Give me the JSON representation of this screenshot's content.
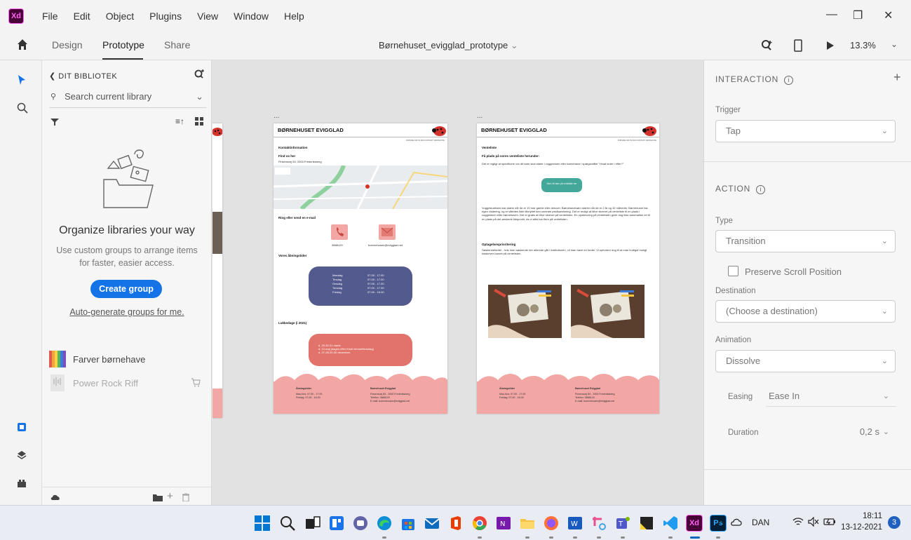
{
  "app": {
    "logo_text": "Xd",
    "menu": [
      "File",
      "Edit",
      "Object",
      "Plugins",
      "View",
      "Window",
      "Help"
    ],
    "document_title": "Børnehuset_evigglad_prototype",
    "zoom": "13.3%"
  },
  "mode_tabs": [
    {
      "label": "Design",
      "active": false
    },
    {
      "label": "Prototype",
      "active": true
    },
    {
      "label": "Share",
      "active": false
    }
  ],
  "library": {
    "back_label": "DIT BIBLIOTEK",
    "search_placeholder": "Search current library",
    "empty_title": "Organize libraries your way",
    "empty_desc": "Use custom groups to arrange items for faster, easier access.",
    "create_group_label": "Create group",
    "auto_generate_label": "Auto-generate groups for me.",
    "items": [
      {
        "label": "Farver børnehave"
      },
      {
        "label": "Power Rock Riff"
      }
    ]
  },
  "artboard_left": {
    "dots": "...",
    "site_title": "BØRNEHUSET EVIGGLAD",
    "nav": "FORSIDE  OM OS  INFO  KONTAKT  VENTELISTE",
    "contact_heading": "Kontaktinformation",
    "find_heading": "Find os her",
    "address": "Finsensvej 83, 2000 Frederiksberg",
    "call_heading": "Ring eller send en e-mail",
    "phone": "3888129",
    "email": "boernehusen@evigglad.net",
    "hours_heading": "Vores åbningstider",
    "hours": [
      {
        "day": "Mandag",
        "time": "07.00 - 17.00"
      },
      {
        "day": "Tirsdag",
        "time": "07.00 - 17.00"
      },
      {
        "day": "Onsdag",
        "time": "07.00 - 17.00"
      },
      {
        "day": "Torsdag",
        "time": "07.00 - 17.00"
      },
      {
        "day": "Fredag",
        "time": "07.00 - 16.00"
      }
    ],
    "closed_heading": "Lukkedage (i 2021)",
    "closed_days": [
      "d. 29-30-31 marts",
      "d. 14 maj (dagen efter Kristi himmelfartsdag)",
      "d. 27-28-29-30 december."
    ],
    "footer_left_title": "Åbningstider",
    "footer_left_lines": [
      "Man-fors: 07.00 - 17.00",
      "Fredag:   07.00 - 16.00"
    ],
    "footer_right_title": "Børnehuset Evigglad",
    "footer_right_lines": [
      "Finsensvej 83 - 2000 Frederiksberg",
      "Telefon: 3888129",
      "E-mail: boernehusen@evigglad.net"
    ]
  },
  "artboard_right": {
    "dots": "...",
    "site_title": "BØRNEHUSET EVIGGLAD",
    "nav": "FORSIDE  OM OS  INFO  KONTAKT  VENTELISTE",
    "waitlist_heading": "Venteliste",
    "waitlist_sub": "Få plads på vores venteliste herunder:",
    "waitlist_text": "Det er vigtigt at specificere om dit barn skal starte i vuggestuen eller børnehave i spørgsmålet \"Hvad leder I efter?\"",
    "signup_button": "Skriv dit barn på venteliste her",
    "body_text": "Vuggestuebørn kan starte når de er 10 mdr gamle eller derover. Børnehavebørn starter når de er 2 år og 10 måneder. Børnehuset har egen visitering, og er således ikke tilknyttet den centrale pladsanvisning. Det er muligt at blive skrevet på venteliste til en plads i vuggestuen eller børnehaven. Det er gratis at blive skrevet på ventelisten. En opskrivning på ventelisten giver dog ikke automatisk ret til en plads på det ønskede tidspunkt, da vi altid har flere på ventelisten.",
    "priority_heading": "Optagelsesprioritering",
    "priority_text": "Søskendefordel - hvis man søskende der allerede går i institutionen, vil man have en fordel. Vi opfordrer dog til at man hurtigst muligt indskriver barnet på ventelisten.",
    "footer_left_title": "Åbningstider",
    "footer_left_lines": [
      "Man-fors: 07.00 - 17.00",
      "Fredag:   07.00 - 16.00"
    ],
    "footer_right_title": "Børnehuset Evigglad",
    "footer_right_lines": [
      "Finsensvej 83 - 2000 Frederiksberg",
      "Telefon: 3888129",
      "E-mail: boernehusen@evigglad.net"
    ]
  },
  "props": {
    "interaction_title": "INTERACTION",
    "trigger_label": "Trigger",
    "trigger_value": "Tap",
    "action_title": "ACTION",
    "type_label": "Type",
    "type_value": "Transition",
    "preserve_scroll_label": "Preserve Scroll Position",
    "destination_label": "Destination",
    "destination_value": "(Choose a destination)",
    "animation_label": "Animation",
    "animation_value": "Dissolve",
    "easing_label": "Easing",
    "easing_value": "Ease In",
    "duration_label": "Duration",
    "duration_value": "0,2 s"
  },
  "taskbar": {
    "language": "DAN",
    "time": "18:11",
    "date": "13-12-2021",
    "notifications": "3",
    "xd_label": "Xd",
    "ps_label": "Ps"
  },
  "colors": {
    "accent_blue": "#1473e6",
    "hours_box": "#535a8e",
    "closed_box": "#e2736b",
    "footer_pink": "#f2a7a5",
    "signup_teal": "#43a79a"
  }
}
